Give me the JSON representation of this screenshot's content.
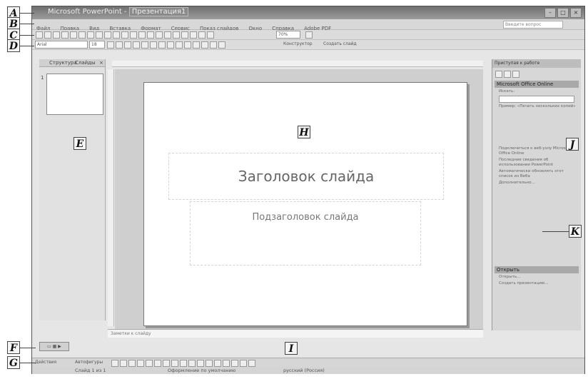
{
  "window": {
    "app_title": "Microsoft PowerPoint",
    "doc_title": "Презентация1"
  },
  "menu": {
    "items": [
      "Файл",
      "Правка",
      "Вид",
      "Вставка",
      "Формат",
      "Сервис",
      "Показ слайдов",
      "Окно",
      "Справка",
      "Adobe PDF"
    ],
    "search_placeholder": "Введите вопрос"
  },
  "formatting": {
    "font_name": "Arial",
    "font_size": "18",
    "design_label": "Конструктор",
    "new_slide_label": "Создать слайд",
    "zoom": "70%"
  },
  "left_pane": {
    "tab_outline": "Структура",
    "tab_slides": "Слайды",
    "slide_number": "1"
  },
  "slide": {
    "title": "Заголовок слайда",
    "subtitle": "Подзаголовок слайда"
  },
  "notes": {
    "placeholder": "Заметки к слайду"
  },
  "task_pane": {
    "header": "Приступая к работе",
    "section1": "Microsoft Office Online",
    "section2": "Открыть",
    "search_label": "Искать:",
    "example": "Пример: «Печать нескольких копий»",
    "links": [
      "Подключиться к веб-узлу Microsoft Office Online",
      "Последние сведения об использовании PowerPoint",
      "Автоматически обновлять этот список из Веба"
    ],
    "more": "Дополнительно...",
    "open_links": [
      "Открыть...",
      "Создать презентацию..."
    ]
  },
  "drawing": {
    "actions_label": "Действия",
    "autoshapes_label": "Автофигуры"
  },
  "status": {
    "slide": "Слайд 1 из 1",
    "design": "Оформление по умолчанию",
    "language": "русский (Россия)"
  },
  "callouts": {
    "A": "A",
    "B": "B",
    "C": "C",
    "D": "D",
    "E": "E",
    "F": "F",
    "G": "G",
    "H": "H",
    "I": "I",
    "J": "J",
    "K": "K"
  }
}
